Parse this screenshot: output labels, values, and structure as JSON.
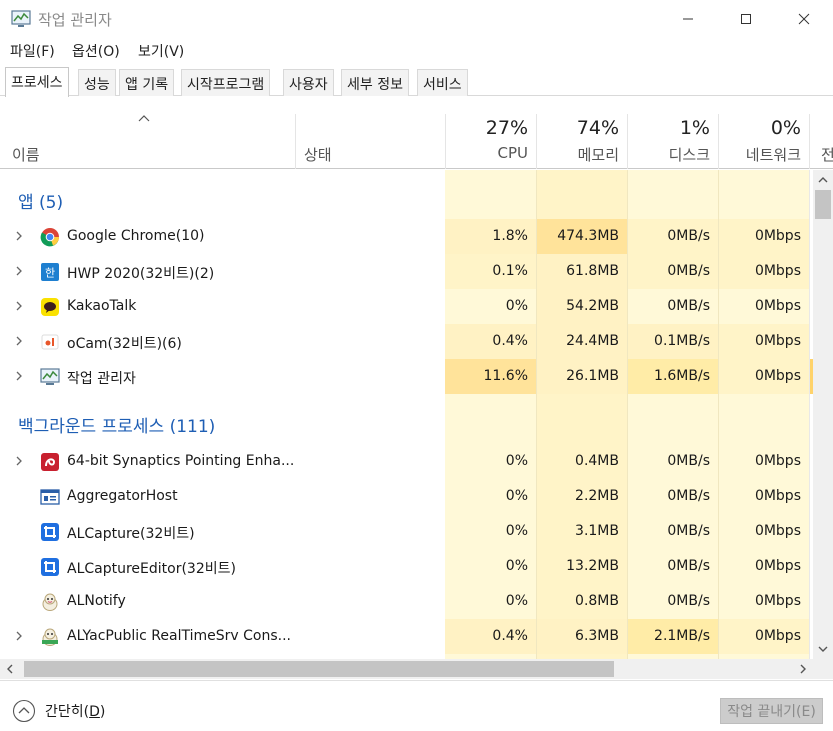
{
  "window": {
    "title": "작업 관리자"
  },
  "menu": [
    {
      "label": "파일(F)"
    },
    {
      "label": "옵션(O)"
    },
    {
      "label": "보기(V)"
    }
  ],
  "tabs": [
    {
      "label": "프로세스",
      "active": true
    },
    {
      "label": "성능"
    },
    {
      "label": "앱 기록"
    },
    {
      "label": "시작프로그램"
    },
    {
      "label": "사용자"
    },
    {
      "label": "세부 정보"
    },
    {
      "label": "서비스"
    }
  ],
  "columns": {
    "name": "이름",
    "status": "상태",
    "cpu": {
      "pct": "27%",
      "label": "CPU"
    },
    "memory": {
      "pct": "74%",
      "label": "메모리"
    },
    "disk": {
      "pct": "1%",
      "label": "디스크"
    },
    "network": {
      "pct": "0%",
      "label": "네트워크"
    },
    "power": {
      "label": "전"
    }
  },
  "groups": {
    "apps": {
      "title": "앱 (5)"
    },
    "background": {
      "title": "백그라운드 프로세스 (111)"
    }
  },
  "app_rows": [
    {
      "name": "Google Chrome(10)",
      "icon": "chrome-icon",
      "expandable": true,
      "cpu": "1.8%",
      "mem": "474.3MB",
      "disk": "0MB/s",
      "net": "0Mbps"
    },
    {
      "name": "HWP 2020(32비트)(2)",
      "icon": "hwp-icon",
      "expandable": true,
      "cpu": "0.1%",
      "mem": "61.8MB",
      "disk": "0MB/s",
      "net": "0Mbps"
    },
    {
      "name": "KakaoTalk",
      "icon": "kakaotalk-icon",
      "expandable": true,
      "cpu": "0%",
      "mem": "54.2MB",
      "disk": "0MB/s",
      "net": "0Mbps"
    },
    {
      "name": "oCam(32비트)(6)",
      "icon": "ocam-icon",
      "expandable": true,
      "cpu": "0.4%",
      "mem": "24.4MB",
      "disk": "0.1MB/s",
      "net": "0Mbps"
    },
    {
      "name": "작업 관리자",
      "icon": "task-manager-icon",
      "expandable": true,
      "cpu": "11.6%",
      "mem": "26.1MB",
      "disk": "1.6MB/s",
      "net": "0Mbps"
    }
  ],
  "bg_rows": [
    {
      "name": "64-bit Synaptics Pointing Enha...",
      "icon": "synaptics-icon",
      "expandable": true,
      "cpu": "0%",
      "mem": "0.4MB",
      "disk": "0MB/s",
      "net": "0Mbps"
    },
    {
      "name": "AggregatorHost",
      "icon": "window-icon",
      "expandable": false,
      "cpu": "0%",
      "mem": "2.2MB",
      "disk": "0MB/s",
      "net": "0Mbps"
    },
    {
      "name": "ALCapture(32비트)",
      "icon": "alcapture-icon",
      "expandable": false,
      "cpu": "0%",
      "mem": "3.1MB",
      "disk": "0MB/s",
      "net": "0Mbps"
    },
    {
      "name": "ALCaptureEditor(32비트)",
      "icon": "alcapture-icon",
      "expandable": false,
      "cpu": "0%",
      "mem": "13.2MB",
      "disk": "0MB/s",
      "net": "0Mbps"
    },
    {
      "name": "ALNotify",
      "icon": "alnotify-icon",
      "expandable": false,
      "cpu": "0%",
      "mem": "0.8MB",
      "disk": "0MB/s",
      "net": "0Mbps"
    },
    {
      "name": "ALYacPublic RealTimeSrv Cons...",
      "icon": "alyac-icon",
      "expandable": true,
      "cpu": "0.4%",
      "mem": "6.3MB",
      "disk": "2.1MB/s",
      "net": "0Mbps"
    }
  ],
  "footer": {
    "fewer_details_prefix": "간단히(",
    "fewer_details_key": "D",
    "fewer_details_suffix": ")",
    "end_task": "작업 끝내기(E)"
  },
  "colors": {
    "heat_light": "#fff9d8",
    "heat_mid": "#fff2c4",
    "heat_strong": "#ffe39a",
    "heat_med": "#ffeca7",
    "group_blue": "#1e5eb4"
  }
}
